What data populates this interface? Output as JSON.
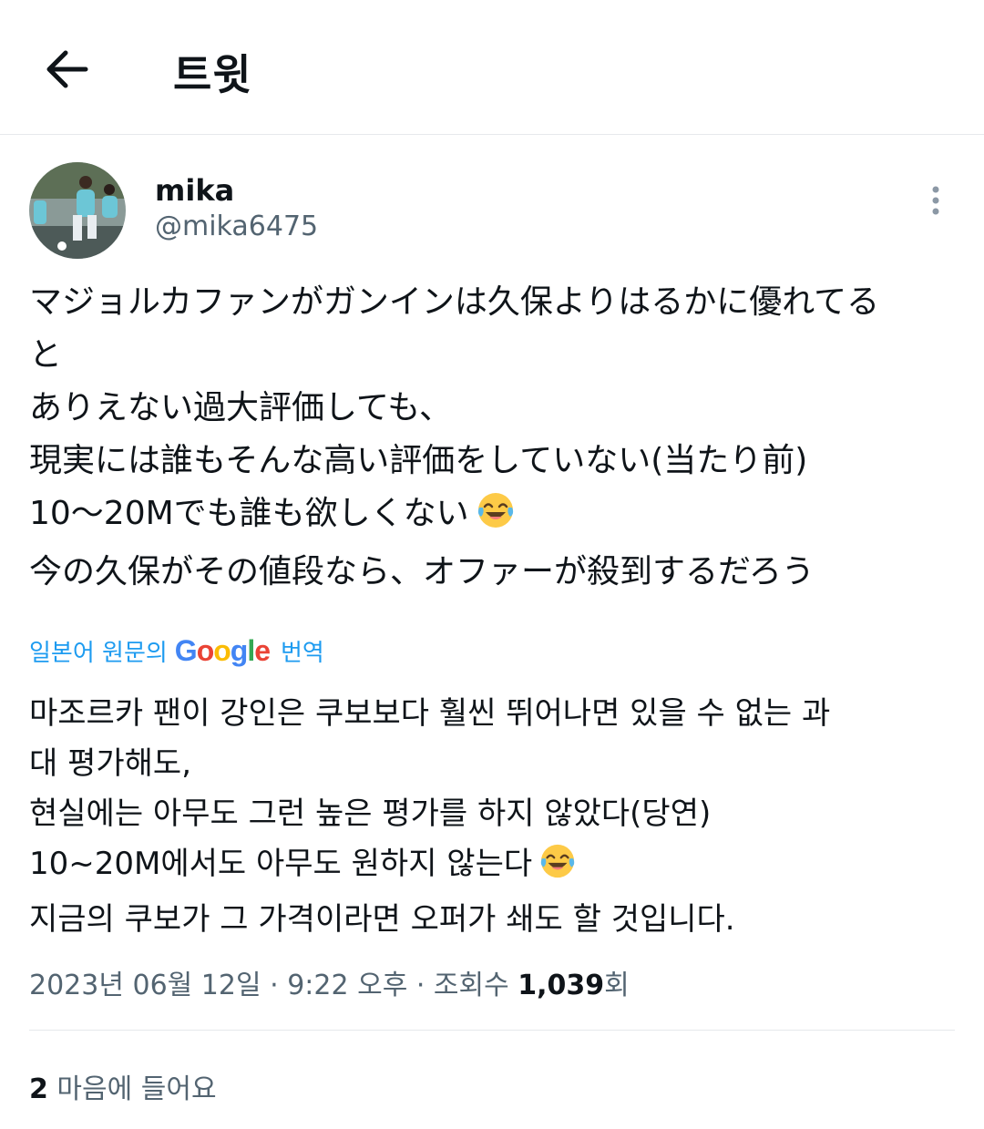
{
  "header": {
    "title": "트윗",
    "back_icon": "arrow-left-icon"
  },
  "author": {
    "name": "mika",
    "handle": "@mika6475"
  },
  "tweet": {
    "lines": [
      "マジョルカファンがガンインは久保よりはるかに優れてる",
      "と",
      "ありえない過大評価しても、",
      "現実には誰もそんな高い評価をしていない(当たり前)",
      "10〜20Mでも誰も欲しくない",
      "今の久保がその値段なら、オファーが殺到するだろう"
    ],
    "emoji": "face-with-tears-of-joy"
  },
  "translation": {
    "prefix": "일본어 원문의",
    "brand": "Google",
    "suffix": "번역",
    "lines": [
      "마조르카 팬이 강인은 쿠보보다 훨씬 뛰어나면 있을 수 없는 과",
      "대 평가해도,",
      "현실에는 아무도 그런 높은 평가를 하지 않았다(당연)",
      "10~20M에서도 아무도 원하지 않는다",
      "지금의 쿠보가 그 가격이라면 오퍼가 쇄도 할 것입니다."
    ]
  },
  "meta": {
    "date": "2023년 06월 12일",
    "sep1": " · ",
    "time": "9:22 오후",
    "sep2": " · ",
    "views_label": "조회수",
    "views_count": "1,039",
    "views_suffix": "회"
  },
  "likes": {
    "count": "2",
    "label": "마음에 들어요"
  },
  "colors": {
    "link": "#1d9bf0",
    "secondary": "#536471",
    "divider": "#e6e9ec"
  }
}
